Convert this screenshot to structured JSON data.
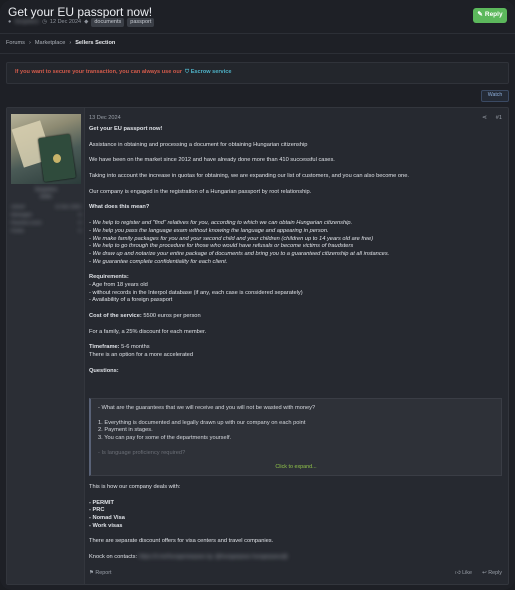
{
  "thread": {
    "title": "Get your EU passport now!",
    "author": "Sergeiknn",
    "date": "12 Dec 2024",
    "tags": [
      "documents",
      "passport"
    ],
    "reply_label": "Reply"
  },
  "breadcrumb": [
    "Forums",
    "Marketplace",
    "Sellers Section"
  ],
  "notice": {
    "warn": "If you want to secure your transaction, you can always use our",
    "link": "Escrow service"
  },
  "watch_label": "Watch",
  "post": {
    "date": "13 Dec 2024",
    "number": "#1",
    "user": {
      "name": "Sergeiknn",
      "rank": "Seller",
      "stats": [
        {
          "label": "Joined",
          "value": "12 Dec 2024"
        },
        {
          "label": "Messages",
          "value": "6"
        },
        {
          "label": "Reaction score",
          "value": "0"
        },
        {
          "label": "Points",
          "value": "0"
        }
      ]
    },
    "lines": {
      "l1": "Get your EU passport now!",
      "l2": "Assistance in obtaining and processing a document for obtaining Hungarian citizenship",
      "l3": "We have been on the market since 2012 and have already done more than 410 successful cases.",
      "l4": "Taking into account the increase in quotas for obtaining, we are expanding our list of customers, and you can also become one.",
      "l5": "Our company is engaged in the registration of a Hungarian passport by root relationship.",
      "l6": "What does this mean?",
      "i1": "- We help to register and \"find\" relatives for you, according to which we can obtain Hungarian citizenship.",
      "i2": "- We help you pass the language exam without knowing the language and appearing in person.",
      "i3": "- We make family packages for you and your second child and your children (children up to 14 years old are free)",
      "i4": "- We help to go through the procedure for those who would have refusals or become victims of fraudsters",
      "i5": "- We draw up and notarize your entire package of documents and bring you to a guaranteed citizenship at all instances.",
      "i6": "- We guarantee complete confidentiality for each client.",
      "r0": "Requirements:",
      "r1": "- Age from 18 years old",
      "r2": "- without records in the Interpol database (if any, each case is considered separately)",
      "r3": "- Availability of a foreign passport",
      "c0": "Cost of the service:",
      "c1": " 5500 euros per person",
      "c2": "For a family, a 25% discount for each member.",
      "t0": "Timeframe:",
      "t1": " 5-6 months",
      "t2": "There is an option for a more accelerated",
      "qh": "Questions:",
      "d1": "This is how our company deals with:",
      "d2": "- PERMIT",
      "d3": "- PRC",
      "d4": "- Nomad Visa",
      "d5": "- Work visas",
      "d6": "There are separate discount offers for visa centers and travel companies.",
      "k0": "Knock on contacts:",
      "k1": "https://t.me/hungarianpass  tg: @hungarpass  hungarpass@"
    },
    "quote": {
      "q1": "- What are the guarantees that we will receive and you will not be wasted with money?",
      "q2": "1. Everything is documented and legally drawn up with our company on each point",
      "q3": "2. Payment in stages.",
      "q4": "3. You can pay for some of the departments yourself.",
      "q5": "- Is language proficiency required?",
      "expand": "Click to expand..."
    },
    "footer": {
      "report": "Report",
      "like": "Like",
      "reply": "Reply"
    }
  }
}
